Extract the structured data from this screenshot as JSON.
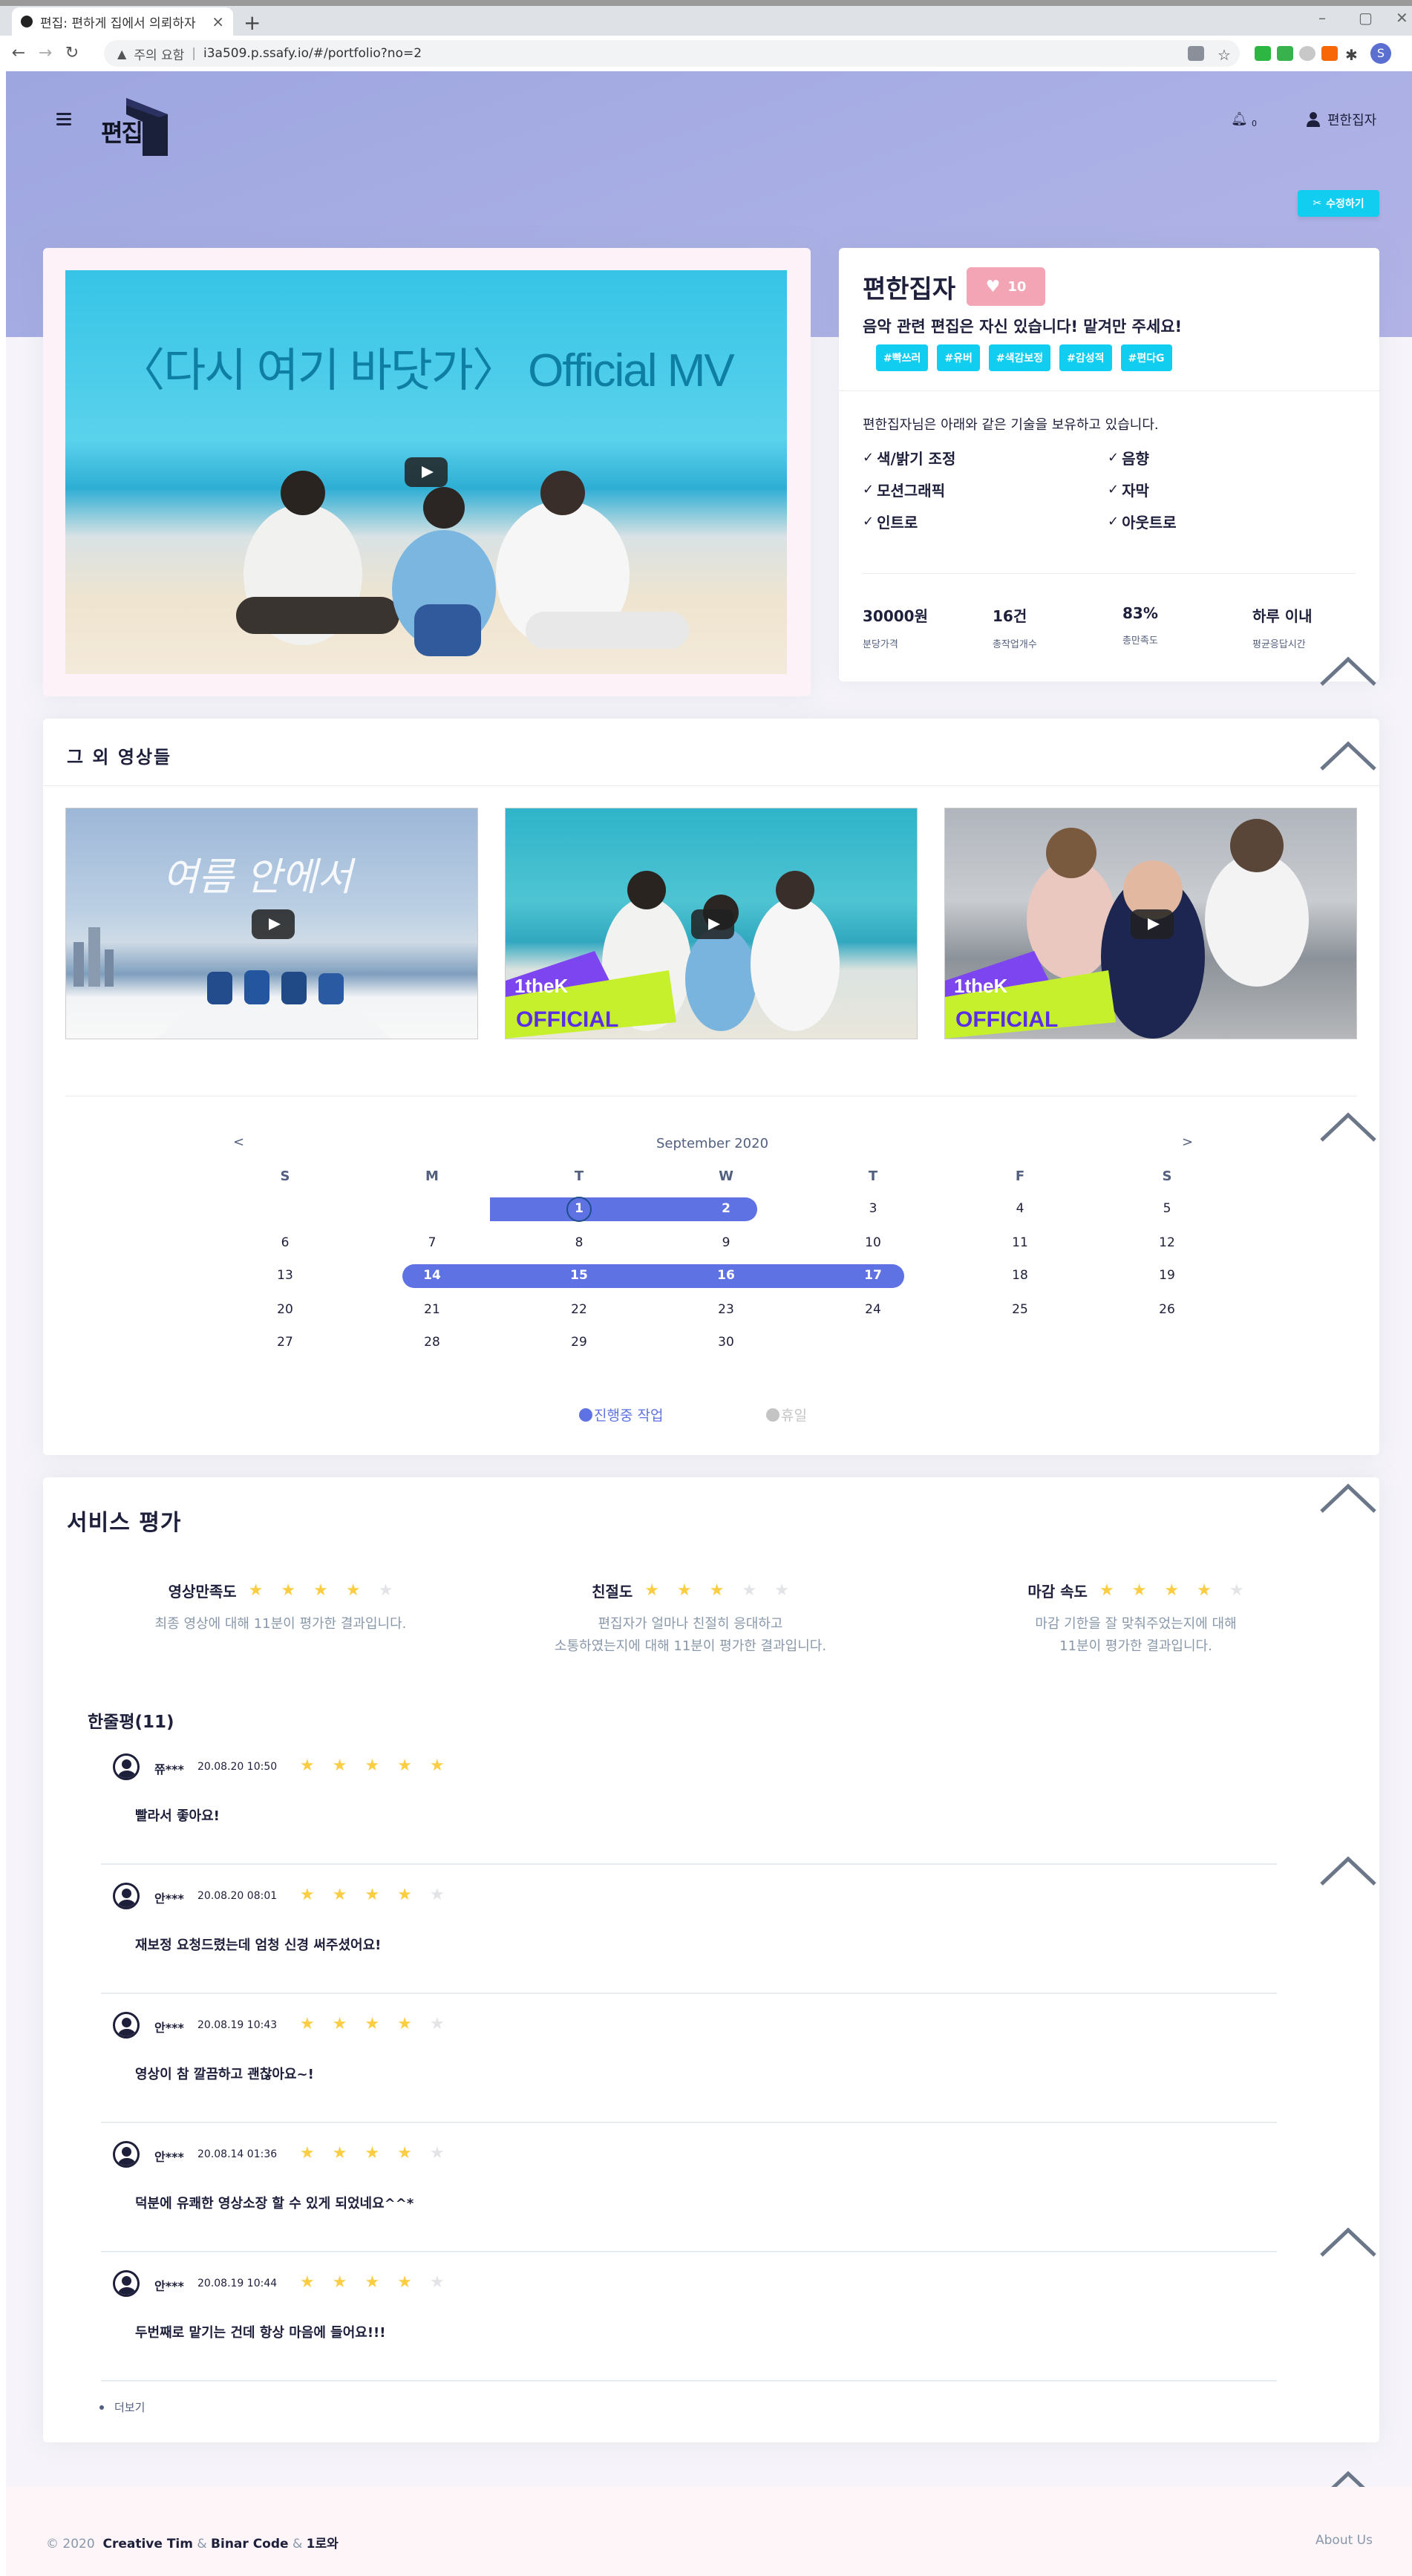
{
  "browser": {
    "tab_title": "편집: 편하게 집에서 의뢰하자",
    "tab_close": "×",
    "new_tab": "+",
    "security_label": "주의 요함",
    "url": "i3a509.p.ssafy.io/#/portfolio?no=2",
    "profile_initial": "S"
  },
  "header": {
    "logo_text": "편집",
    "notification_count": "0",
    "user_name": "편한집자",
    "edit_button": "수정하기"
  },
  "profile": {
    "name": "편한집자",
    "likes": "10",
    "intro": "음악 관련 편집은 자신 있습니다! 맡겨만 주세요!",
    "tags": [
      "#빡쓰러",
      "#유버",
      "#색감보정",
      "#감성적",
      "#편다G"
    ],
    "skills_desc": "편한집자님은 아래와 같은 기술을 보유하고 있습니다.",
    "skills": [
      "색/밝기 조정",
      "음향",
      "모션그래픽",
      "자막",
      "인트로",
      "아웃트로"
    ],
    "stats": [
      {
        "value": "30000원",
        "label": "분당가격"
      },
      {
        "value": "16건",
        "label": "총작업개수"
      },
      {
        "value": "83%",
        "label": "총만족도"
      },
      {
        "value": "하루 이내",
        "label": "평균응답시간"
      }
    ]
  },
  "main_video": {
    "title_text": "〈다시 여기 바닷가〉 Official MV"
  },
  "others": {
    "title": "그 외 영상들",
    "thumb1_text": "여름 안에서",
    "thumb_badge_top": "1theK",
    "thumb_badge_bottom": "OFFICIAL"
  },
  "calendar": {
    "prev": "<",
    "next": ">",
    "month": "September 2020",
    "weekdays": [
      "S",
      "M",
      "T",
      "W",
      "T",
      "F",
      "S"
    ],
    "weeks": [
      [
        "",
        "",
        "1",
        "2",
        "3",
        "4",
        "5"
      ],
      [
        "6",
        "7",
        "8",
        "9",
        "10",
        "11",
        "12"
      ],
      [
        "13",
        "14",
        "15",
        "16",
        "17",
        "18",
        "19"
      ],
      [
        "20",
        "21",
        "22",
        "23",
        "24",
        "25",
        "26"
      ],
      [
        "27",
        "28",
        "29",
        "30",
        "",
        "",
        ""
      ]
    ],
    "highlighted_days": [
      "1",
      "2",
      "14",
      "15",
      "16",
      "17"
    ],
    "today": "1",
    "legend_working": "진행중 작업",
    "legend_holiday": "휴일",
    "color_working": "#5e72e4",
    "color_holiday": "#c4c4c4"
  },
  "reviews": {
    "title": "서비스 평가",
    "ratings": [
      {
        "label": "영상만족도",
        "stars": 4,
        "desc_line1": "최종 영상에 대해 11분이 평가한 결과입니다.",
        "desc_line2": ""
      },
      {
        "label": "친절도",
        "stars": 3,
        "desc_line1": "편집자가 얼마나 친절히 응대하고",
        "desc_line2": "소통하였는지에 대해 11분이 평가한 결과입니다."
      },
      {
        "label": "마감 속도",
        "stars": 4,
        "desc_line1": "마감 기한을 잘 맞춰주었는지에 대해",
        "desc_line2": "11분이 평가한 결과입니다."
      }
    ],
    "oneline_title": "한줄평(11)",
    "items": [
      {
        "user": "쮸***",
        "date": "20.08.20 10:50",
        "stars": 5,
        "text": "빨라서 좋아요!"
      },
      {
        "user": "안***",
        "date": "20.08.20 08:01",
        "stars": 4,
        "text": "재보정 요청드렸는데 엄청 신경 써주셨어요!"
      },
      {
        "user": "안***",
        "date": "20.08.19 10:43",
        "stars": 4,
        "text": "영상이 참 깔끔하고 괜찮아요~!"
      },
      {
        "user": "안***",
        "date": "20.08.14 01:36",
        "stars": 4,
        "text": "덕분에 유쾌한 영상소장 할 수 있게 되었네요^^*"
      },
      {
        "user": "안***",
        "date": "20.08.19 10:44",
        "stars": 4,
        "text": "두번째로 맡기는 건데 항상 마음에 들어요!!!"
      }
    ],
    "more": "더보기"
  },
  "footer": {
    "year": "© 2020",
    "author1": "Creative Tim",
    "amp": "&",
    "author2": "Binar Code",
    "author3": "1로와",
    "about": "About Us"
  },
  "colors": {
    "accent": "#11cdef",
    "primary": "#5e72e4",
    "star": "#fbcd42",
    "like": "#f3a4b5"
  }
}
